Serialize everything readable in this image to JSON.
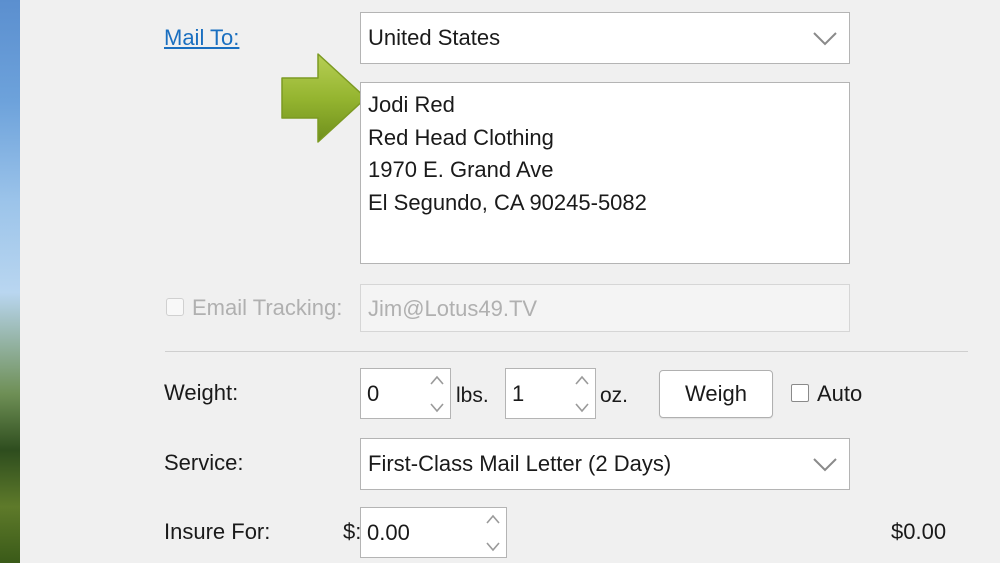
{
  "mail_to": {
    "label": "Mail To:",
    "country": "United States",
    "address_lines": "Jodi Red\nRed Head Clothing\n1970 E. Grand Ave\nEl Segundo, CA 90245-5082"
  },
  "email_tracking": {
    "label": "Email Tracking:",
    "value": "Jim@Lotus49.TV",
    "checked": false
  },
  "weight": {
    "label": "Weight:",
    "lbs_value": "0",
    "lbs_unit": "lbs.",
    "oz_value": "1",
    "oz_unit": "oz.",
    "weigh_button": "Weigh",
    "auto_label": "Auto",
    "auto_checked": false
  },
  "service": {
    "label": "Service:",
    "value": "First-Class Mail Letter (2 Days)"
  },
  "insure": {
    "label": "Insure For:",
    "currency_prefix": "$:",
    "value": "0.00",
    "cost": "$0.00"
  },
  "colors": {
    "link": "#1a6fc0",
    "arrow_green": "#8fb22e",
    "panel_bg": "#f0f0f0"
  }
}
